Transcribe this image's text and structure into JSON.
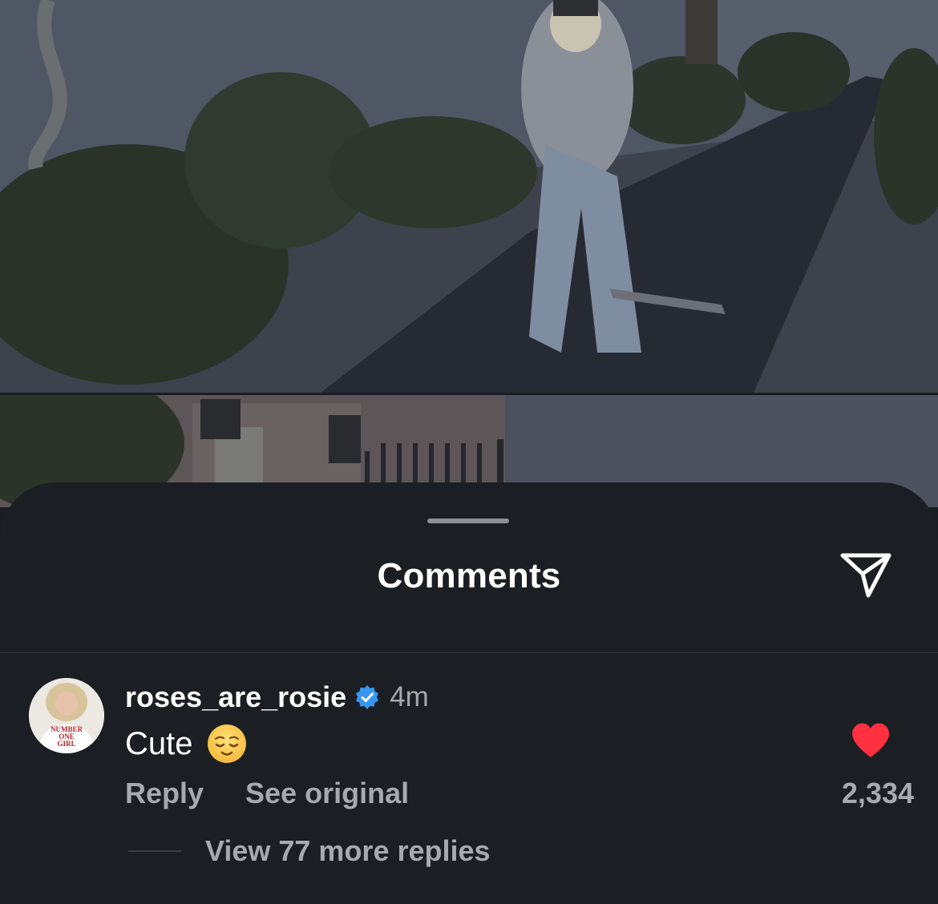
{
  "sheet": {
    "title": "Comments"
  },
  "comment": {
    "username": "roses_are_rosie",
    "verified": true,
    "time": "4m",
    "text": "Cute",
    "emoji": "😌",
    "avatar_shirt_text": [
      "NUMBER",
      "ONE",
      "GIRL"
    ],
    "reply_label": "Reply",
    "see_original_label": "See original",
    "liked": true,
    "like_count": "2,334",
    "view_replies_label": "View 77 more replies"
  },
  "colors": {
    "sheet_bg": "#1b1e22",
    "text_primary": "#ffffff",
    "text_secondary": "#a5a9b0",
    "verified_blue": "#3797f0",
    "like_red": "#ff3040"
  },
  "icons": {
    "share": "paper-plane-icon",
    "verified": "verified-badge-icon",
    "like": "heart-icon"
  }
}
